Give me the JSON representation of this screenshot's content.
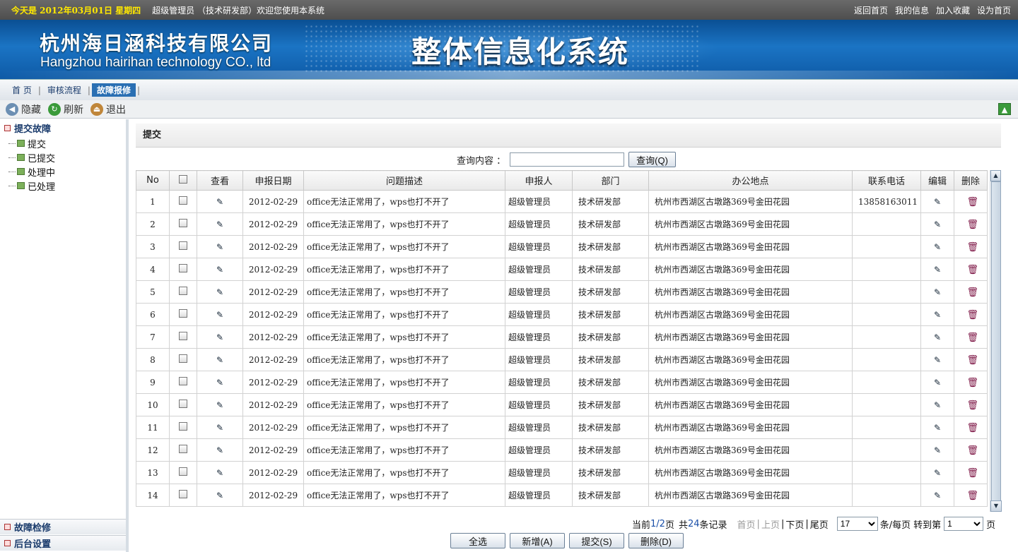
{
  "topbar": {
    "today": "今天是  2012年03月01日  星期四",
    "welcome": "超级管理员 （技术研发部）欢迎您使用本系统",
    "links": [
      "返回首页",
      "我的信息",
      "加入收藏",
      "设为首页"
    ]
  },
  "banner": {
    "company_cn": "杭州海日涵科技有限公司",
    "company_en": "Hangzhou hairihan technology CO., ltd",
    "system_name": "整体信息化系统"
  },
  "nav": {
    "items": [
      "首 页",
      "审核流程",
      "故障报修"
    ],
    "active_index": 2
  },
  "toolbar": {
    "hide_label": "隐藏",
    "refresh_label": "刷新",
    "exit_label": "退出"
  },
  "sidebar": {
    "section_title": "提交故障",
    "tree": [
      "提交",
      "已提交",
      "处理中",
      "已处理"
    ],
    "bottom_sections": [
      "故障检修",
      "后台设置"
    ]
  },
  "main": {
    "panel_title": "提交",
    "search": {
      "label": "查询内容 ：",
      "value": "",
      "button": "查询(Q)"
    },
    "table": {
      "headers": [
        "No",
        "",
        "查看",
        "申报日期",
        "问题描述",
        "申报人",
        "部门",
        "办公地点",
        "联系电话",
        "编辑",
        "删除"
      ],
      "rows": [
        {
          "no": "1",
          "date": "2012-02-29",
          "desc": "office无法正常用了，wps也打不开了",
          "reporter": "超级管理员",
          "dept": "技术研发部",
          "location": "杭州市西湖区古墩路369号金田花园",
          "phone": "13858163011"
        },
        {
          "no": "2",
          "date": "2012-02-29",
          "desc": "office无法正常用了，wps也打不开了",
          "reporter": "超级管理员",
          "dept": "技术研发部",
          "location": "杭州市西湖区古墩路369号金田花园",
          "phone": ""
        },
        {
          "no": "3",
          "date": "2012-02-29",
          "desc": "office无法正常用了，wps也打不开了",
          "reporter": "超级管理员",
          "dept": "技术研发部",
          "location": "杭州市西湖区古墩路369号金田花园",
          "phone": ""
        },
        {
          "no": "4",
          "date": "2012-02-29",
          "desc": "office无法正常用了，wps也打不开了",
          "reporter": "超级管理员",
          "dept": "技术研发部",
          "location": "杭州市西湖区古墩路369号金田花园",
          "phone": ""
        },
        {
          "no": "5",
          "date": "2012-02-29",
          "desc": "office无法正常用了，wps也打不开了",
          "reporter": "超级管理员",
          "dept": "技术研发部",
          "location": "杭州市西湖区古墩路369号金田花园",
          "phone": ""
        },
        {
          "no": "6",
          "date": "2012-02-29",
          "desc": "office无法正常用了，wps也打不开了",
          "reporter": "超级管理员",
          "dept": "技术研发部",
          "location": "杭州市西湖区古墩路369号金田花园",
          "phone": ""
        },
        {
          "no": "7",
          "date": "2012-02-29",
          "desc": "office无法正常用了，wps也打不开了",
          "reporter": "超级管理员",
          "dept": "技术研发部",
          "location": "杭州市西湖区古墩路369号金田花园",
          "phone": ""
        },
        {
          "no": "8",
          "date": "2012-02-29",
          "desc": "office无法正常用了，wps也打不开了",
          "reporter": "超级管理员",
          "dept": "技术研发部",
          "location": "杭州市西湖区古墩路369号金田花园",
          "phone": ""
        },
        {
          "no": "9",
          "date": "2012-02-29",
          "desc": "office无法正常用了，wps也打不开了",
          "reporter": "超级管理员",
          "dept": "技术研发部",
          "location": "杭州市西湖区古墩路369号金田花园",
          "phone": ""
        },
        {
          "no": "10",
          "date": "2012-02-29",
          "desc": "office无法正常用了，wps也打不开了",
          "reporter": "超级管理员",
          "dept": "技术研发部",
          "location": "杭州市西湖区古墩路369号金田花园",
          "phone": ""
        },
        {
          "no": "11",
          "date": "2012-02-29",
          "desc": "office无法正常用了，wps也打不开了",
          "reporter": "超级管理员",
          "dept": "技术研发部",
          "location": "杭州市西湖区古墩路369号金田花园",
          "phone": ""
        },
        {
          "no": "12",
          "date": "2012-02-29",
          "desc": "office无法正常用了，wps也打不开了",
          "reporter": "超级管理员",
          "dept": "技术研发部",
          "location": "杭州市西湖区古墩路369号金田花园",
          "phone": ""
        },
        {
          "no": "13",
          "date": "2012-02-29",
          "desc": "office无法正常用了，wps也打不开了",
          "reporter": "超级管理员",
          "dept": "技术研发部",
          "location": "杭州市西湖区古墩路369号金田花园",
          "phone": ""
        },
        {
          "no": "14",
          "date": "2012-02-29",
          "desc": "office无法正常用了，wps也打不开了",
          "reporter": "超级管理员",
          "dept": "技术研发部",
          "location": "杭州市西湖区古墩路369号金田花园",
          "phone": ""
        }
      ]
    },
    "pager": {
      "current_prefix": "当前",
      "current_page": "1/2",
      "current_suffix": "页",
      "total_prefix": "共",
      "total": "24",
      "total_suffix": "条记录",
      "first": "首页",
      "prev": "上页",
      "next": "下页",
      "last": "尾页",
      "per_page": "17",
      "per_page_label": "条/每页",
      "goto_label": "转到第",
      "goto_page": "1",
      "page_label": "页"
    },
    "buttons": [
      "全选",
      "新增(A)",
      "提交(S)",
      "删除(D)"
    ]
  },
  "icons": {
    "view": "pencil-icon",
    "edit": "pencil-icon",
    "delete": "trash-icon",
    "hide": "arrow-left-icon",
    "refresh": "refresh-icon",
    "exit": "exit-icon",
    "scroll_top": "arrow-up-icon"
  },
  "colors": {
    "accent": "#2a6fb3",
    "today": "#ffe800",
    "banner": "#1b74c4",
    "page_link": "#1a4fa8"
  }
}
